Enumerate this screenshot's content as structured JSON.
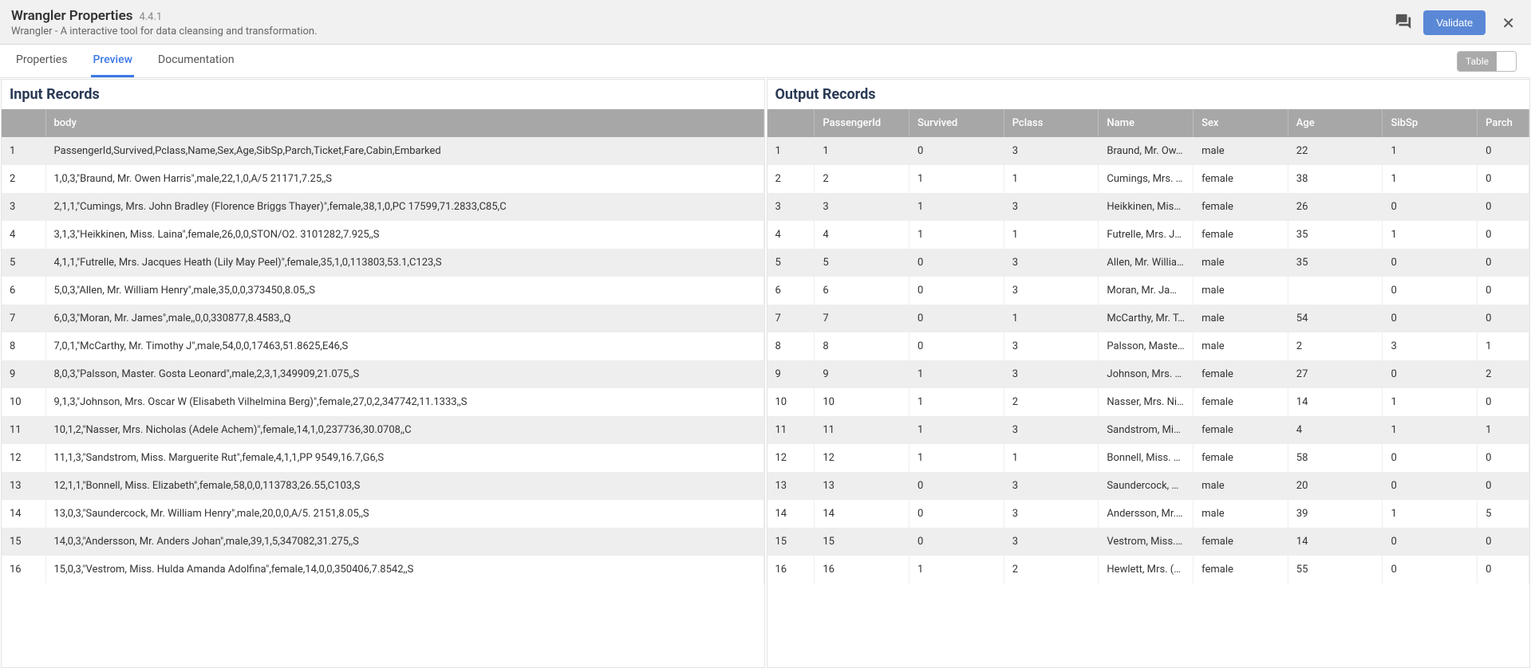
{
  "header": {
    "title": "Wrangler Properties",
    "version": "4.4.1",
    "subtitle": "Wrangler - A interactive tool for data cleansing and transformation.",
    "validate_label": "Validate"
  },
  "tabs": {
    "properties": "Properties",
    "preview": "Preview",
    "documentation": "Documentation",
    "active": "preview",
    "view_toggle_label": "Table"
  },
  "input": {
    "title": "Input Records",
    "columns": [
      "",
      "body"
    ],
    "rows": [
      {
        "n": "1",
        "body": "PassengerId,Survived,Pclass,Name,Sex,Age,SibSp,Parch,Ticket,Fare,Cabin,Embarked"
      },
      {
        "n": "2",
        "body": "1,0,3,\"Braund, Mr. Owen Harris\",male,22,1,0,A/5 21171,7.25,,S"
      },
      {
        "n": "3",
        "body": "2,1,1,\"Cumings, Mrs. John Bradley (Florence Briggs Thayer)\",female,38,1,0,PC 17599,71.2833,C85,C"
      },
      {
        "n": "4",
        "body": "3,1,3,\"Heikkinen, Miss. Laina\",female,26,0,0,STON/O2. 3101282,7.925,,S"
      },
      {
        "n": "5",
        "body": "4,1,1,\"Futrelle, Mrs. Jacques Heath (Lily May Peel)\",female,35,1,0,113803,53.1,C123,S"
      },
      {
        "n": "6",
        "body": "5,0,3,\"Allen, Mr. William Henry\",male,35,0,0,373450,8.05,,S"
      },
      {
        "n": "7",
        "body": "6,0,3,\"Moran, Mr. James\",male,,0,0,330877,8.4583,,Q"
      },
      {
        "n": "8",
        "body": "7,0,1,\"McCarthy, Mr. Timothy J\",male,54,0,0,17463,51.8625,E46,S"
      },
      {
        "n": "9",
        "body": "8,0,3,\"Palsson, Master. Gosta Leonard\",male,2,3,1,349909,21.075,,S"
      },
      {
        "n": "10",
        "body": "9,1,3,\"Johnson, Mrs. Oscar W (Elisabeth Vilhelmina Berg)\",female,27,0,2,347742,11.1333,,S"
      },
      {
        "n": "11",
        "body": "10,1,2,\"Nasser, Mrs. Nicholas (Adele Achem)\",female,14,1,0,237736,30.0708,,C"
      },
      {
        "n": "12",
        "body": "11,1,3,\"Sandstrom, Miss. Marguerite Rut\",female,4,1,1,PP 9549,16.7,G6,S"
      },
      {
        "n": "13",
        "body": "12,1,1,\"Bonnell, Miss. Elizabeth\",female,58,0,0,113783,26.55,C103,S"
      },
      {
        "n": "14",
        "body": "13,0,3,\"Saundercock, Mr. William Henry\",male,20,0,0,A/5. 2151,8.05,,S"
      },
      {
        "n": "15",
        "body": "14,0,3,\"Andersson, Mr. Anders Johan\",male,39,1,5,347082,31.275,,S"
      },
      {
        "n": "16",
        "body": "15,0,3,\"Vestrom, Miss. Hulda Amanda Adolfina\",female,14,0,0,350406,7.8542,,S"
      }
    ]
  },
  "output": {
    "title": "Output Records",
    "columns": [
      "",
      "PassengerId",
      "Survived",
      "Pclass",
      "Name",
      "Sex",
      "Age",
      "SibSp",
      "Parch"
    ],
    "rows": [
      {
        "n": "1",
        "PassengerId": "1",
        "Survived": "0",
        "Pclass": "3",
        "Name": "Braund, Mr. Ow…",
        "Sex": "male",
        "Age": "22",
        "SibSp": "1",
        "Parch": "0"
      },
      {
        "n": "2",
        "PassengerId": "2",
        "Survived": "1",
        "Pclass": "1",
        "Name": "Cumings, Mrs. …",
        "Sex": "female",
        "Age": "38",
        "SibSp": "1",
        "Parch": "0"
      },
      {
        "n": "3",
        "PassengerId": "3",
        "Survived": "1",
        "Pclass": "3",
        "Name": "Heikkinen, Mis…",
        "Sex": "female",
        "Age": "26",
        "SibSp": "0",
        "Parch": "0"
      },
      {
        "n": "4",
        "PassengerId": "4",
        "Survived": "1",
        "Pclass": "1",
        "Name": "Futrelle, Mrs. J…",
        "Sex": "female",
        "Age": "35",
        "SibSp": "1",
        "Parch": "0"
      },
      {
        "n": "5",
        "PassengerId": "5",
        "Survived": "0",
        "Pclass": "3",
        "Name": "Allen, Mr. Willia…",
        "Sex": "male",
        "Age": "35",
        "SibSp": "0",
        "Parch": "0"
      },
      {
        "n": "6",
        "PassengerId": "6",
        "Survived": "0",
        "Pclass": "3",
        "Name": "Moran, Mr. Jam…",
        "Sex": "male",
        "Age": "",
        "SibSp": "0",
        "Parch": "0"
      },
      {
        "n": "7",
        "PassengerId": "7",
        "Survived": "0",
        "Pclass": "1",
        "Name": "McCarthy, Mr. T…",
        "Sex": "male",
        "Age": "54",
        "SibSp": "0",
        "Parch": "0"
      },
      {
        "n": "8",
        "PassengerId": "8",
        "Survived": "0",
        "Pclass": "3",
        "Name": "Palsson, Maste…",
        "Sex": "male",
        "Age": "2",
        "SibSp": "3",
        "Parch": "1"
      },
      {
        "n": "9",
        "PassengerId": "9",
        "Survived": "1",
        "Pclass": "3",
        "Name": "Johnson, Mrs. …",
        "Sex": "female",
        "Age": "27",
        "SibSp": "0",
        "Parch": "2"
      },
      {
        "n": "10",
        "PassengerId": "10",
        "Survived": "1",
        "Pclass": "2",
        "Name": "Nasser, Mrs. Ni…",
        "Sex": "female",
        "Age": "14",
        "SibSp": "1",
        "Parch": "0"
      },
      {
        "n": "11",
        "PassengerId": "11",
        "Survived": "1",
        "Pclass": "3",
        "Name": "Sandstrom, Mis…",
        "Sex": "female",
        "Age": "4",
        "SibSp": "1",
        "Parch": "1"
      },
      {
        "n": "12",
        "PassengerId": "12",
        "Survived": "1",
        "Pclass": "1",
        "Name": "Bonnell, Miss. …",
        "Sex": "female",
        "Age": "58",
        "SibSp": "0",
        "Parch": "0"
      },
      {
        "n": "13",
        "PassengerId": "13",
        "Survived": "0",
        "Pclass": "3",
        "Name": "Saundercock, …",
        "Sex": "male",
        "Age": "20",
        "SibSp": "0",
        "Parch": "0"
      },
      {
        "n": "14",
        "PassengerId": "14",
        "Survived": "0",
        "Pclass": "3",
        "Name": "Andersson, Mr. …",
        "Sex": "male",
        "Age": "39",
        "SibSp": "1",
        "Parch": "5"
      },
      {
        "n": "15",
        "PassengerId": "15",
        "Survived": "0",
        "Pclass": "3",
        "Name": "Vestrom, Miss. …",
        "Sex": "female",
        "Age": "14",
        "SibSp": "0",
        "Parch": "0"
      },
      {
        "n": "16",
        "PassengerId": "16",
        "Survived": "1",
        "Pclass": "2",
        "Name": "Hewlett, Mrs. (…",
        "Sex": "female",
        "Age": "55",
        "SibSp": "0",
        "Parch": "0"
      }
    ]
  }
}
